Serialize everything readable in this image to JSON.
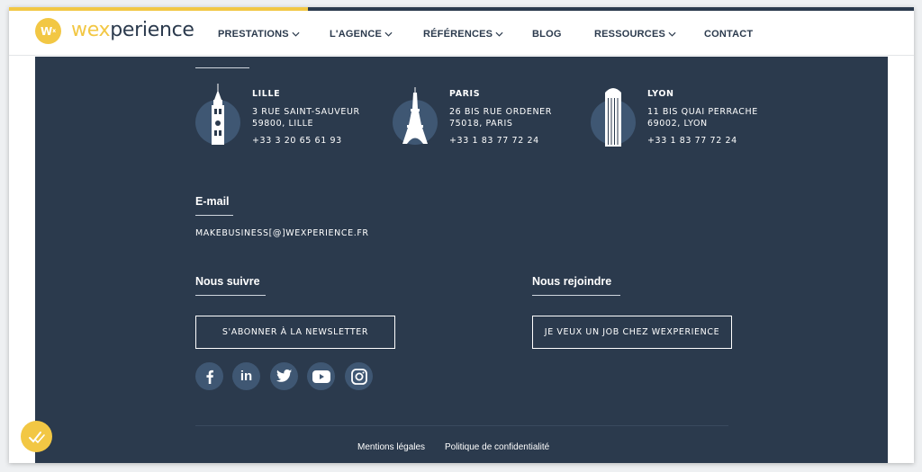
{
  "colors": {
    "accent": "#f2c744",
    "panel": "#2b3a4d",
    "icon_circle": "#3f5773"
  },
  "progress": {
    "value_percent": 33
  },
  "logo": {
    "badge_text": "W",
    "badge_sup": "x",
    "text_accent": "wex",
    "text_rest": "perience"
  },
  "nav": {
    "items": [
      {
        "label": "PRESTATIONS",
        "dropdown": true
      },
      {
        "label": "L'AGENCE",
        "dropdown": true
      },
      {
        "label": "RÉFÉRENCES",
        "dropdown": true
      },
      {
        "label": "BLOG",
        "dropdown": false
      },
      {
        "label": "RESSOURCES",
        "dropdown": true
      },
      {
        "label": "CONTACT",
        "dropdown": false
      }
    ]
  },
  "offices": [
    {
      "city": "LILLE",
      "line1": "3 RUE SAINT-SAUVEUR",
      "line2": "59800, LILLE",
      "phone": "+33 3 20 65 61 93",
      "icon": "belfry-icon"
    },
    {
      "city": "PARIS",
      "line1": "26 BIS RUE ORDENER",
      "line2": "75018, PARIS",
      "phone": "+33 1 83 77 72 24",
      "icon": "eiffel-tower-icon"
    },
    {
      "city": "LYON",
      "line1": "11 BIS QUAI PERRACHE",
      "line2": "69002, LYON",
      "phone": "+33 1 83 77 72 24",
      "icon": "skyscraper-icon"
    }
  ],
  "email_section": {
    "title": "E-mail",
    "address": "MAKEBUSINESS[@]WEXPERIENCE.FR"
  },
  "follow": {
    "title": "Nous suivre",
    "button": "S'ABONNER À LA NEWSLETTER"
  },
  "join": {
    "title": "Nous rejoindre",
    "button": "JE VEUX UN JOB CHEZ WEXPERIENCE"
  },
  "social": [
    "facebook-icon",
    "linkedin-icon",
    "twitter-icon",
    "youtube-icon",
    "instagram-icon"
  ],
  "legal": {
    "mentions": "Mentions légales",
    "privacy": "Politique de confidentialité"
  }
}
